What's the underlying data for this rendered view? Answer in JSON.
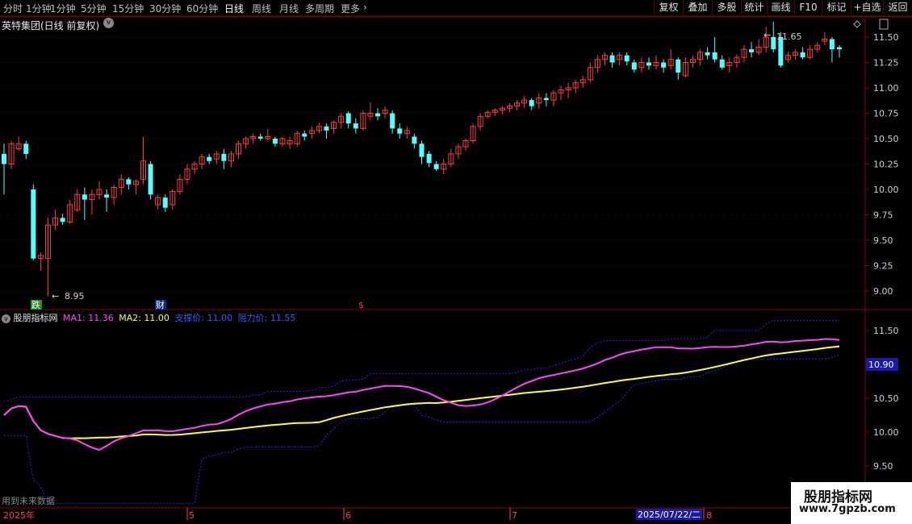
{
  "toolbar": {
    "timeframes": [
      "分时",
      "1分钟",
      "5分钟",
      "15分钟",
      "30分钟",
      "60分钟",
      "日线",
      "周线",
      "月线",
      "多周期",
      "更多"
    ],
    "active": "日线",
    "right_buttons": [
      "复权",
      "叠加",
      "多股",
      "统计",
      "画线",
      "F10",
      "标记",
      "+自选",
      "返回"
    ]
  },
  "chart_title": "英特集团(日线 前复权)",
  "price_axis": [
    "11.50",
    "11.25",
    "11.00",
    "10.75",
    "10.50",
    "10.25",
    "10.00",
    "9.75",
    "9.50",
    "9.25",
    "9.00"
  ],
  "high_label": "11.65",
  "low_label": "8.95",
  "markers": {
    "left": "跌",
    "mid": "财",
    "red": "$"
  },
  "indicator": {
    "name": "股朋指标网",
    "ma1_label": "MA1: 11.36",
    "ma2_label": "MA2: 11.00",
    "support_label": "支撑价: 11.00",
    "resist_label": "阻力价: 11.55",
    "axis": [
      "11.50",
      "10.50",
      "10.00",
      "9.50"
    ],
    "current": "10.90"
  },
  "future_note": "用到未来数据",
  "date_axis": [
    "2025年",
    "5",
    "6",
    "7",
    "8"
  ],
  "cursor_date": "2025/07/22/二",
  "watermark": {
    "title": "股朋指标网",
    "url": "www.7gpzb.com"
  },
  "colors": {
    "up": "#ff3c3c",
    "down": "#54ffff",
    "ma1": "#ff44ff",
    "ma1_dn": "#44ff44",
    "ma2": "#ffff33",
    "ma2_alt": "#33ffff",
    "band": "#2222ff"
  },
  "chart_data": {
    "type": "candlestick",
    "ylim": [
      8.85,
      11.62
    ],
    "candles": [
      {
        "o": 10.35,
        "c": 10.25,
        "h": 10.45,
        "l": 9.95
      },
      {
        "o": 10.25,
        "c": 10.45,
        "h": 10.48,
        "l": 10.2
      },
      {
        "o": 10.4,
        "c": 10.45,
        "h": 10.52,
        "l": 10.38
      },
      {
        "o": 10.45,
        "c": 10.35,
        "h": 10.48,
        "l": 10.3
      },
      {
        "o": 10.0,
        "c": 9.32,
        "h": 10.05,
        "l": 9.3
      },
      {
        "o": 9.32,
        "c": 9.35,
        "h": 9.38,
        "l": 9.2
      },
      {
        "o": 9.32,
        "c": 9.65,
        "h": 9.72,
        "l": 8.95
      },
      {
        "o": 9.65,
        "c": 9.72,
        "h": 9.8,
        "l": 9.6
      },
      {
        "o": 9.72,
        "c": 9.68,
        "h": 9.76,
        "l": 9.65
      },
      {
        "o": 9.68,
        "c": 9.85,
        "h": 9.9,
        "l": 9.66
      },
      {
        "o": 9.8,
        "c": 9.95,
        "h": 10.0,
        "l": 9.78
      },
      {
        "o": 9.95,
        "c": 9.9,
        "h": 10.02,
        "l": 9.7
      },
      {
        "o": 9.9,
        "c": 9.95,
        "h": 10.0,
        "l": 9.75
      },
      {
        "o": 9.95,
        "c": 10.0,
        "h": 10.08,
        "l": 9.9
      },
      {
        "o": 9.95,
        "c": 9.92,
        "h": 10.0,
        "l": 9.78
      },
      {
        "o": 9.92,
        "c": 10.02,
        "h": 10.05,
        "l": 9.85
      },
      {
        "o": 10.02,
        "c": 10.1,
        "h": 10.15,
        "l": 9.95
      },
      {
        "o": 10.1,
        "c": 10.05,
        "h": 10.12,
        "l": 10.0
      },
      {
        "o": 10.05,
        "c": 10.08,
        "h": 10.1,
        "l": 9.95
      },
      {
        "o": 10.1,
        "c": 10.28,
        "h": 10.52,
        "l": 10.05
      },
      {
        "o": 10.25,
        "c": 9.95,
        "h": 10.28,
        "l": 9.9
      },
      {
        "o": 9.85,
        "c": 9.92,
        "h": 9.95,
        "l": 9.8
      },
      {
        "o": 9.92,
        "c": 9.82,
        "h": 9.95,
        "l": 9.78
      },
      {
        "o": 9.85,
        "c": 9.98,
        "h": 10.0,
        "l": 9.8
      },
      {
        "o": 9.98,
        "c": 10.1,
        "h": 10.15,
        "l": 9.95
      },
      {
        "o": 10.1,
        "c": 10.2,
        "h": 10.25,
        "l": 10.05
      },
      {
        "o": 10.2,
        "c": 10.25,
        "h": 10.28,
        "l": 10.15
      },
      {
        "o": 10.25,
        "c": 10.32,
        "h": 10.35,
        "l": 10.2
      },
      {
        "o": 10.32,
        "c": 10.28,
        "h": 10.35,
        "l": 10.25
      },
      {
        "o": 10.3,
        "c": 10.35,
        "h": 10.38,
        "l": 10.25
      },
      {
        "o": 10.35,
        "c": 10.28,
        "h": 10.4,
        "l": 10.2
      },
      {
        "o": 10.28,
        "c": 10.35,
        "h": 10.38,
        "l": 10.22
      },
      {
        "o": 10.35,
        "c": 10.45,
        "h": 10.48,
        "l": 10.3
      },
      {
        "o": 10.45,
        "c": 10.5,
        "h": 10.52,
        "l": 10.4
      },
      {
        "o": 10.5,
        "c": 10.52,
        "h": 10.55,
        "l": 10.45
      },
      {
        "o": 10.52,
        "c": 10.5,
        "h": 10.55,
        "l": 10.48
      },
      {
        "o": 10.5,
        "c": 10.52,
        "h": 10.6,
        "l": 10.48
      },
      {
        "o": 10.5,
        "c": 10.45,
        "h": 10.52,
        "l": 10.42
      },
      {
        "o": 10.45,
        "c": 10.5,
        "h": 10.52,
        "l": 10.42
      },
      {
        "o": 10.45,
        "c": 10.48,
        "h": 10.52,
        "l": 10.4
      },
      {
        "o": 10.45,
        "c": 10.55,
        "h": 10.58,
        "l": 10.42
      },
      {
        "o": 10.55,
        "c": 10.52,
        "h": 10.58,
        "l": 10.48
      },
      {
        "o": 10.55,
        "c": 10.58,
        "h": 10.62,
        "l": 10.5
      },
      {
        "o": 10.58,
        "c": 10.62,
        "h": 10.66,
        "l": 10.55
      },
      {
        "o": 10.62,
        "c": 10.58,
        "h": 10.65,
        "l": 10.5
      },
      {
        "o": 10.6,
        "c": 10.66,
        "h": 10.68,
        "l": 10.55
      },
      {
        "o": 10.66,
        "c": 10.72,
        "h": 10.75,
        "l": 10.6
      },
      {
        "o": 10.75,
        "c": 10.65,
        "h": 10.77,
        "l": 10.6
      },
      {
        "o": 10.65,
        "c": 10.6,
        "h": 10.7,
        "l": 10.55
      },
      {
        "o": 10.6,
        "c": 10.75,
        "h": 10.78,
        "l": 10.58
      },
      {
        "o": 10.72,
        "c": 10.75,
        "h": 10.86,
        "l": 10.68
      },
      {
        "o": 10.75,
        "c": 10.72,
        "h": 10.8,
        "l": 10.68
      },
      {
        "o": 10.75,
        "c": 10.78,
        "h": 10.82,
        "l": 10.7
      },
      {
        "o": 10.75,
        "c": 10.6,
        "h": 10.78,
        "l": 10.55
      },
      {
        "o": 10.6,
        "c": 10.55,
        "h": 10.65,
        "l": 10.5
      },
      {
        "o": 10.55,
        "c": 10.58,
        "h": 10.62,
        "l": 10.5
      },
      {
        "o": 10.52,
        "c": 10.45,
        "h": 10.55,
        "l": 10.4
      },
      {
        "o": 10.45,
        "c": 10.32,
        "h": 10.48,
        "l": 10.25
      },
      {
        "o": 10.35,
        "c": 10.26,
        "h": 10.38,
        "l": 10.22
      },
      {
        "o": 10.25,
        "c": 10.2,
        "h": 10.28,
        "l": 10.18
      },
      {
        "o": 10.2,
        "c": 10.25,
        "h": 10.3,
        "l": 10.15
      },
      {
        "o": 10.25,
        "c": 10.35,
        "h": 10.4,
        "l": 10.22
      },
      {
        "o": 10.35,
        "c": 10.42,
        "h": 10.45,
        "l": 10.3
      },
      {
        "o": 10.42,
        "c": 10.48,
        "h": 10.5,
        "l": 10.38
      },
      {
        "o": 10.48,
        "c": 10.62,
        "h": 10.65,
        "l": 10.45
      },
      {
        "o": 10.62,
        "c": 10.72,
        "h": 10.75,
        "l": 10.58
      },
      {
        "o": 10.72,
        "c": 10.76,
        "h": 10.78,
        "l": 10.7
      },
      {
        "o": 10.76,
        "c": 10.78,
        "h": 10.8,
        "l": 10.72
      },
      {
        "o": 10.78,
        "c": 10.8,
        "h": 10.82,
        "l": 10.74
      },
      {
        "o": 10.8,
        "c": 10.82,
        "h": 10.85,
        "l": 10.76
      },
      {
        "o": 10.82,
        "c": 10.85,
        "h": 10.88,
        "l": 10.78
      },
      {
        "o": 10.85,
        "c": 10.88,
        "h": 10.92,
        "l": 10.8
      },
      {
        "o": 10.88,
        "c": 10.82,
        "h": 10.9,
        "l": 10.78
      },
      {
        "o": 10.85,
        "c": 10.9,
        "h": 10.95,
        "l": 10.8
      },
      {
        "o": 10.9,
        "c": 10.88,
        "h": 10.95,
        "l": 10.82
      },
      {
        "o": 10.88,
        "c": 10.95,
        "h": 10.98,
        "l": 10.82
      },
      {
        "o": 10.95,
        "c": 10.98,
        "h": 11.02,
        "l": 10.88
      },
      {
        "o": 10.98,
        "c": 11.0,
        "h": 11.05,
        "l": 10.9
      },
      {
        "o": 11.0,
        "c": 11.05,
        "h": 11.08,
        "l": 10.95
      },
      {
        "o": 11.05,
        "c": 11.08,
        "h": 11.12,
        "l": 11.0
      },
      {
        "o": 11.08,
        "c": 11.2,
        "h": 11.25,
        "l": 11.05
      },
      {
        "o": 11.2,
        "c": 11.28,
        "h": 11.32,
        "l": 11.15
      },
      {
        "o": 11.28,
        "c": 11.32,
        "h": 11.35,
        "l": 11.22
      },
      {
        "o": 11.32,
        "c": 11.25,
        "h": 11.35,
        "l": 11.2
      },
      {
        "o": 11.28,
        "c": 11.32,
        "h": 11.35,
        "l": 11.22
      },
      {
        "o": 11.32,
        "c": 11.26,
        "h": 11.35,
        "l": 11.22
      },
      {
        "o": 11.25,
        "c": 11.18,
        "h": 11.28,
        "l": 11.15
      },
      {
        "o": 11.2,
        "c": 11.25,
        "h": 11.3,
        "l": 11.15
      },
      {
        "o": 11.25,
        "c": 11.22,
        "h": 11.3,
        "l": 11.18
      },
      {
        "o": 11.22,
        "c": 11.25,
        "h": 11.32,
        "l": 11.18
      },
      {
        "o": 11.25,
        "c": 11.2,
        "h": 11.28,
        "l": 11.15
      },
      {
        "o": 11.22,
        "c": 11.28,
        "h": 11.38,
        "l": 11.18
      },
      {
        "o": 11.28,
        "c": 11.15,
        "h": 11.3,
        "l": 11.08
      },
      {
        "o": 11.12,
        "c": 11.25,
        "h": 11.3,
        "l": 11.1
      },
      {
        "o": 11.25,
        "c": 11.28,
        "h": 11.32,
        "l": 11.2
      },
      {
        "o": 11.28,
        "c": 11.35,
        "h": 11.38,
        "l": 11.22
      },
      {
        "o": 11.35,
        "c": 11.32,
        "h": 11.4,
        "l": 11.28
      },
      {
        "o": 11.35,
        "c": 11.28,
        "h": 11.5,
        "l": 11.25
      },
      {
        "o": 11.28,
        "c": 11.2,
        "h": 11.32,
        "l": 11.18
      },
      {
        "o": 11.22,
        "c": 11.25,
        "h": 11.3,
        "l": 11.15
      },
      {
        "o": 11.25,
        "c": 11.3,
        "h": 11.33,
        "l": 11.2
      },
      {
        "o": 11.3,
        "c": 11.38,
        "h": 11.42,
        "l": 11.25
      },
      {
        "o": 11.38,
        "c": 11.35,
        "h": 11.45,
        "l": 11.3
      },
      {
        "o": 11.35,
        "c": 11.4,
        "h": 11.48,
        "l": 11.32
      },
      {
        "o": 11.4,
        "c": 11.5,
        "h": 11.6,
        "l": 11.35
      },
      {
        "o": 11.5,
        "c": 11.38,
        "h": 11.65,
        "l": 11.35
      },
      {
        "o": 11.5,
        "c": 11.22,
        "h": 11.55,
        "l": 11.2
      },
      {
        "o": 11.28,
        "c": 11.32,
        "h": 11.36,
        "l": 11.25
      },
      {
        "o": 11.32,
        "c": 11.35,
        "h": 11.38,
        "l": 11.28
      },
      {
        "o": 11.35,
        "c": 11.3,
        "h": 11.4,
        "l": 11.28
      },
      {
        "o": 11.3,
        "c": 11.38,
        "h": 11.42,
        "l": 11.28
      },
      {
        "o": 11.38,
        "c": 11.42,
        "h": 11.45,
        "l": 11.35
      },
      {
        "o": 11.46,
        "c": 11.48,
        "h": 11.55,
        "l": 11.42
      },
      {
        "o": 11.48,
        "c": 11.38,
        "h": 11.5,
        "l": 11.25
      },
      {
        "o": 11.4,
        "c": 11.38,
        "h": 11.42,
        "l": 11.3
      }
    ]
  }
}
